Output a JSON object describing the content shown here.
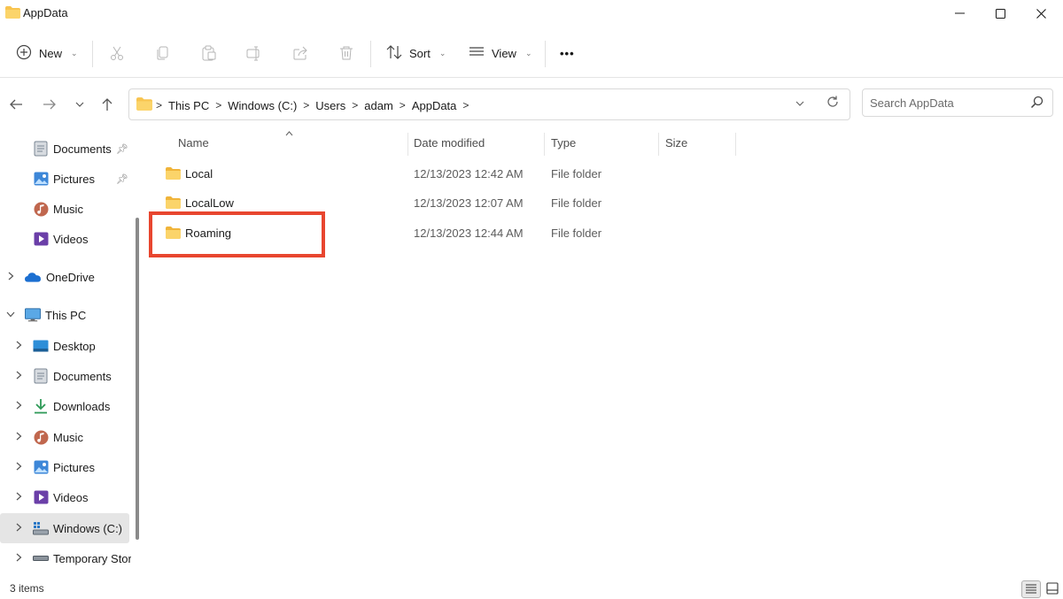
{
  "window": {
    "title": "AppData",
    "minimize_glyph": "—",
    "maximize_glyph": "☐",
    "close_glyph": "✕"
  },
  "toolbar": {
    "new_label": "New",
    "sort_label": "Sort",
    "view_label": "View",
    "more_label": "•••",
    "icons": [
      "plus-circle-icon",
      "cut-icon",
      "copy-icon",
      "paste-icon",
      "rename-icon",
      "share-icon",
      "delete-icon",
      "sort-icon",
      "view-icon",
      "more-icon"
    ]
  },
  "address": {
    "crumbs": [
      "This PC",
      "Windows (C:)",
      "Users",
      "adam",
      "AppData"
    ],
    "separator": ">"
  },
  "search": {
    "placeholder": "Search AppData"
  },
  "sidebar": {
    "items": [
      {
        "label": "Documents",
        "icon": "documents-icon",
        "pinned": true
      },
      {
        "label": "Pictures",
        "icon": "pictures-icon",
        "pinned": true
      },
      {
        "label": "Music",
        "icon": "music-icon"
      },
      {
        "label": "Videos",
        "icon": "videos-icon"
      },
      {
        "label": "OneDrive",
        "icon": "onedrive-icon"
      },
      {
        "label": "This PC",
        "icon": "computer-icon"
      },
      {
        "label": "Desktop",
        "icon": "desktop-icon"
      },
      {
        "label": "Documents",
        "icon": "documents-icon"
      },
      {
        "label": "Downloads",
        "icon": "downloads-icon"
      },
      {
        "label": "Music",
        "icon": "music-icon"
      },
      {
        "label": "Pictures",
        "icon": "pictures-icon"
      },
      {
        "label": "Videos",
        "icon": "videos-icon"
      },
      {
        "label": "Windows (C:)",
        "icon": "drive-icon",
        "selected": true
      },
      {
        "label": "Temporary Stor",
        "icon": "removable-drive-icon"
      }
    ]
  },
  "columns": {
    "name": "Name",
    "date": "Date modified",
    "type": "Type",
    "size": "Size"
  },
  "files": [
    {
      "name": "Local",
      "date": "12/13/2023 12:42 AM",
      "type": "File folder"
    },
    {
      "name": "LocalLow",
      "date": "12/13/2023 12:07 AM",
      "type": "File folder"
    },
    {
      "name": "Roaming",
      "date": "12/13/2023 12:44 AM",
      "type": "File folder"
    }
  ],
  "status": {
    "count": "3 items"
  },
  "colors": {
    "highlight": "#e8462f",
    "folder": "#f8c44f",
    "selection": "#e5e5e5"
  }
}
